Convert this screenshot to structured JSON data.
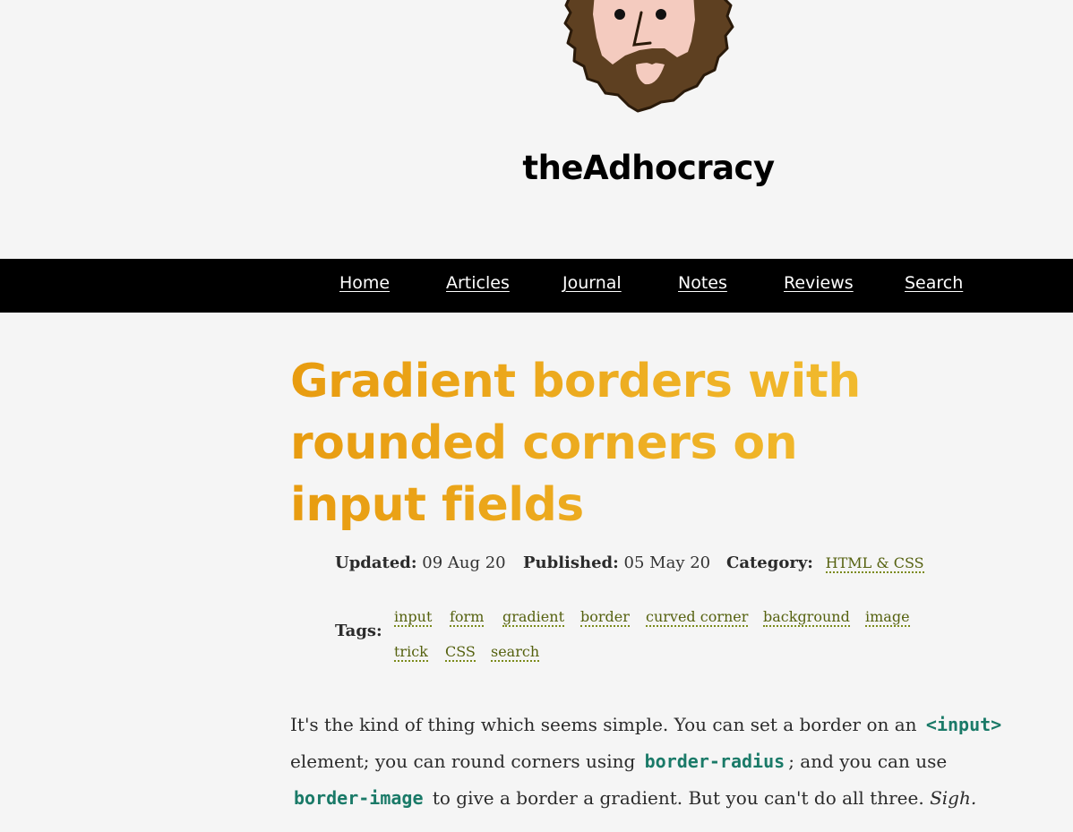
{
  "site": {
    "title": "theAdhocracy"
  },
  "nav": {
    "items": [
      {
        "label": "Home"
      },
      {
        "label": "Articles"
      },
      {
        "label": "Journal"
      },
      {
        "label": "Notes"
      },
      {
        "label": "Reviews"
      },
      {
        "label": "Search"
      }
    ]
  },
  "post": {
    "title": "Gradient borders with rounded corners on input fields",
    "meta": {
      "updated_label": "Updated:",
      "updated_value": "09 Aug 20",
      "published_label": "Published:",
      "published_value": "05 May 20",
      "category_label": "Category:",
      "category_value": "HTML & CSS"
    },
    "tags_label": "Tags:",
    "tags": [
      "input",
      "form",
      "gradient",
      "border",
      "curved corner",
      "background",
      "image",
      "trick",
      "CSS",
      "search"
    ],
    "intro": {
      "t1": "It's the kind of thing which seems simple. You can set a border on an ",
      "c1": "<input>",
      "t2": " element; you can round corners using ",
      "c2": "border-radius",
      "t3": "; and you can use ",
      "c3": "border-image",
      "t4": " to give a border a gradient. But you can't do all three. ",
      "t5": "Sigh."
    }
  },
  "colors": {
    "nav_bg": "#000000",
    "title_gradient_start": "#e89c10",
    "title_gradient_end": "#f2bd31",
    "link_color": "#55610f",
    "code_color": "#1a7a68",
    "beard": "#5e4021",
    "skin": "#f4cbbf"
  }
}
